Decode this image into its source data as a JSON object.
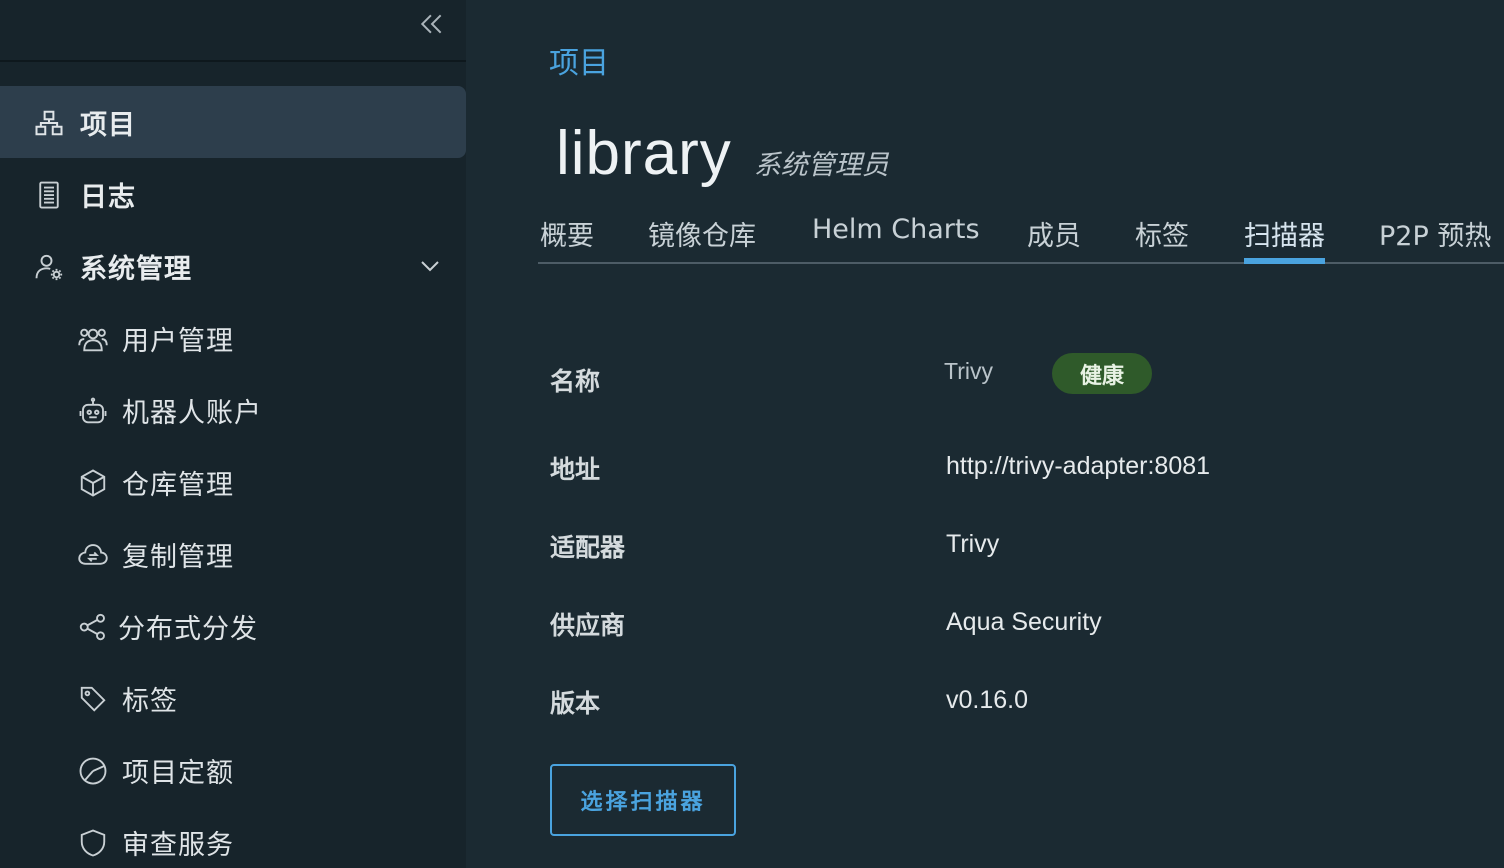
{
  "sidebar": {
    "collapse_icon": "double-chevron-left-icon",
    "items": [
      {
        "label": "项目",
        "icon": "project-tree-icon",
        "active": true
      },
      {
        "label": "日志",
        "icon": "log-list-icon"
      },
      {
        "label": "系统管理",
        "icon": "user-gear-icon",
        "expanded": true
      }
    ],
    "sub_items": [
      {
        "label": "用户管理",
        "icon": "users-icon"
      },
      {
        "label": "机器人账户",
        "icon": "robot-icon"
      },
      {
        "label": "仓库管理",
        "icon": "cube-icon"
      },
      {
        "label": "复制管理",
        "icon": "cloud-sync-icon"
      },
      {
        "label": "分布式分发",
        "icon": "share-icon"
      },
      {
        "label": "标签",
        "icon": "tag-icon"
      },
      {
        "label": "项目定额",
        "icon": "pie-icon"
      },
      {
        "label": "审查服务",
        "icon": "shield-icon"
      }
    ]
  },
  "main": {
    "breadcrumb": "项目",
    "title": "library",
    "role": "系统管理员",
    "tabs": [
      {
        "label": "概要"
      },
      {
        "label": "镜像仓库"
      },
      {
        "label": "Helm Charts"
      },
      {
        "label": "成员"
      },
      {
        "label": "标签"
      },
      {
        "label": "扫描器",
        "active": true
      },
      {
        "label": "P2P 预热"
      }
    ],
    "scanner": {
      "name_label": "名称",
      "name_value": "Trivy",
      "health_badge": "健康",
      "address_label": "地址",
      "address_value": "http://trivy-adapter:8081",
      "adapter_label": "适配器",
      "adapter_value": "Trivy",
      "vendor_label": "供应商",
      "vendor_value": "Aqua Security",
      "version_label": "版本",
      "version_value": "v0.16.0"
    },
    "select_button": "选择扫描器"
  },
  "colors": {
    "sidebar_bg": "#17242b",
    "main_bg": "#1b2a32",
    "active_item_bg": "#2d3e4c",
    "accent": "#4aa3df",
    "healthy_badge": "#2f5a2a"
  }
}
